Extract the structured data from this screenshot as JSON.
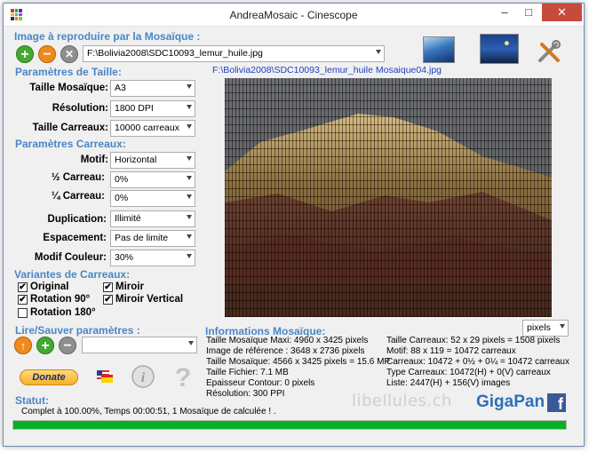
{
  "window": {
    "title": "AndreaMosaic - Cinescope",
    "minimize": "–",
    "maximize": "□",
    "close": "✕"
  },
  "image_section": {
    "label": "Image à reproduire par la Mosaïque :",
    "path": "F:\\Bolivia2008\\SDC10093_lemur_huile.jpg",
    "output_path": "F:\\Bolivia2008\\SDC10093_lemur_huile Mosaique04.jpg",
    "buttons": {
      "add": "+",
      "remove": "−",
      "clear": "✕"
    }
  },
  "tile_params": {
    "label": "Paramètres de Taille:",
    "rows": [
      {
        "label": "Taille Mosaïque:",
        "value": "A3"
      },
      {
        "label": "Résolution:",
        "value": "1800 DPI"
      },
      {
        "label": "Taille Carreaux:",
        "value": "10000 carreaux"
      }
    ]
  },
  "tile_settings": {
    "label": "Paramètres Carreaux:",
    "rows": [
      {
        "label": "Motif:",
        "value": "Horizontal"
      },
      {
        "label": "½  Carreau:",
        "value": "0%"
      },
      {
        "label": "¼  Carreau:",
        "value": "0%"
      },
      {
        "label": "Duplication:",
        "value": "Illimité"
      },
      {
        "label": "Espacement:",
        "value": "Pas de limite"
      },
      {
        "label": "Modif Couleur:",
        "value": "30%"
      }
    ]
  },
  "variants": {
    "label": "Variantes de Carreaux:",
    "original": {
      "label": "Original",
      "checked": "✔"
    },
    "miroir": {
      "label": "Miroir",
      "checked": "✔"
    },
    "rotation90": {
      "label": "Rotation 90°",
      "checked": "✔"
    },
    "miroir_vertical": {
      "label": "Miroir Vertical",
      "checked": "✔"
    },
    "rotation180": {
      "label": "Rotation 180°",
      "checked": ""
    }
  },
  "load_save": {
    "label": "Lire/Sauver paramètres :",
    "up": "↑",
    "add": "+",
    "remove": "−"
  },
  "donate": {
    "label": "Donate"
  },
  "info": {
    "label": "Informations Mosaïque:",
    "unit": "pixels",
    "left": [
      "Taille Mosaïque Maxi: 4960 x 3425 pixels",
      "Image de référence : 3648 x 2736 pixels",
      "Taille Mosaïque: 4566 x 3425 pixels = 15.6 MP",
      "Taille Fichier: 7.1 MB",
      "Epaisseur Contour: 0 pixels",
      "Résolution: 300 PPI"
    ],
    "right": [
      "Taille Carreaux: 52 x 29 pixels = 1508 pixels",
      "Motif: 88 x 119 = 10472 carreaux",
      "Carreaux: 10472 + 0½ + 0¼ = 10472 carreaux",
      "Type Carreaux: 10472(H) + 0(V) carreaux",
      "Liste: 2447(H) + 156(V) images"
    ]
  },
  "status": {
    "label": "Statut:",
    "text": "Complet à 100.00%, Temps 00:00:51, 1 Mosaïque de calculée ! .",
    "progress": 1.0
  },
  "branding": {
    "site": "libellules.ch",
    "gigapan": "GigaPan",
    "facebook": "f"
  },
  "colors": {
    "accent": "#4a86c6",
    "progress": "#06b025"
  }
}
